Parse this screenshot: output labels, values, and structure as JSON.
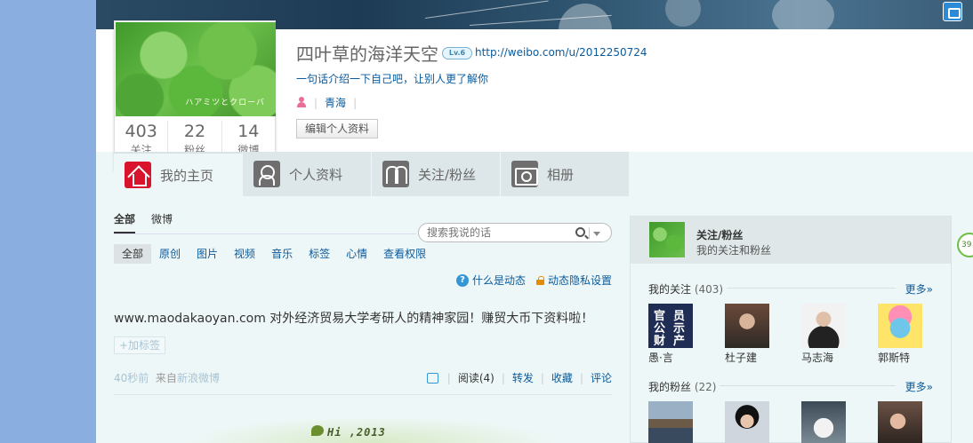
{
  "profile": {
    "name": "四叶草的海洋天空",
    "level_badge": "Lv.6",
    "url": "http://weibo.com/u/2012250724",
    "intro": "一句话介绍一下自己吧，让别人更了解你",
    "location": "青海",
    "edit_label": "编辑个人资料",
    "avatar_text": "ハアミツとクローバ",
    "stats": [
      {
        "num": "403",
        "label": "关注"
      },
      {
        "num": "22",
        "label": "粉丝"
      },
      {
        "num": "14",
        "label": "微博"
      }
    ]
  },
  "tabs": [
    {
      "label": "我的主页",
      "icon": "home-icon"
    },
    {
      "label": "个人资料",
      "icon": "person-icon"
    },
    {
      "label": "关注/粉丝",
      "icon": "people-icon"
    },
    {
      "label": "相册",
      "icon": "camera-icon"
    }
  ],
  "feed": {
    "subtabs": [
      "全部",
      "微博"
    ],
    "search_placeholder": "搜索我说的话",
    "filters": [
      "全部",
      "原创",
      "图片",
      "视频",
      "音乐",
      "标签",
      "心情",
      "查看权限"
    ],
    "what_is_feed": "什么是动态",
    "privacy_settings": "动态隐私设置",
    "post": {
      "text": "www.maodakaoyan.com 对外经济贸易大学考研人的精神家园！赚贸大币下资料啦！",
      "tag_button": "+加标签",
      "time": "40秒前",
      "from_label": "来自",
      "source": "新浪微博",
      "read": "阅读(4)",
      "repost": "转发",
      "favorite": "收藏",
      "comment": "评论"
    },
    "banner_text": "Hi ,2013"
  },
  "sidebar": {
    "title": "关注/粉丝",
    "subtitle": "我的关注和粉丝",
    "following_title": "我的关注",
    "following_count": "(403)",
    "fans_title": "我的粉丝",
    "fans_count": "(22)",
    "more": "更多»",
    "following": [
      {
        "name": "愚·言"
      },
      {
        "name": "杜子建"
      },
      {
        "name": "马志海"
      },
      {
        "name": "郭斯特"
      }
    ],
    "pic1_chars": [
      "官",
      "员",
      "公",
      "示",
      "财",
      "产"
    ]
  },
  "float_badge": "39"
}
